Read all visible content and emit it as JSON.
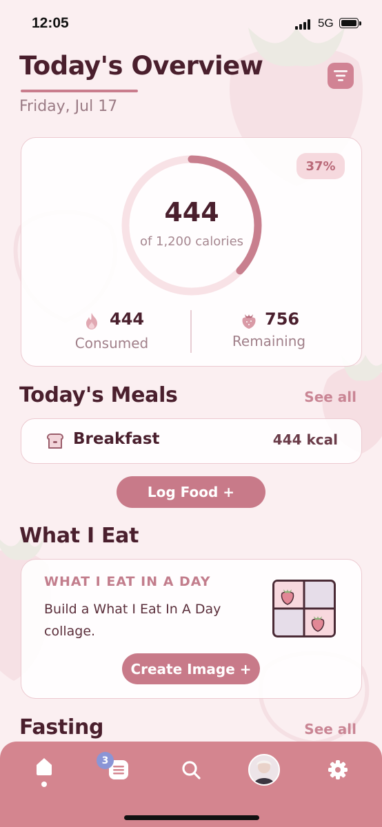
{
  "status_bar": {
    "time": "12:05",
    "network": "5G"
  },
  "header": {
    "title": "Today's Overview",
    "date": "Friday, Jul 17"
  },
  "icons": {
    "filter": "filter-icon",
    "flame": "flame-icon",
    "strawberry": "strawberry-icon",
    "toast": "toast-icon",
    "home": "home-icon",
    "list": "list-icon",
    "search": "search-icon",
    "gear": "gear-icon"
  },
  "summary": {
    "percent_label": "37%",
    "progress": 0.37,
    "consumed": "444",
    "goal_label": "of 1,200 calories",
    "consumed_label": "Consumed",
    "remaining": "756",
    "remaining_label": "Remaining"
  },
  "meals": {
    "title": "Today's Meals",
    "see_all": "See all",
    "items": [
      {
        "name": "Breakfast",
        "kcal": "444 kcal"
      }
    ],
    "log_food_label": "Log Food +"
  },
  "what_i_eat": {
    "title": "What I Eat",
    "kicker": "WHAT I EAT IN A DAY",
    "description": "Build a What I Eat In A Day collage.",
    "button_label": "Create Image +"
  },
  "fasting": {
    "title": "Fasting",
    "see_all": "See all"
  },
  "nav": {
    "notification_count": "3"
  },
  "colors": {
    "accent": "#c87a89",
    "nav_background": "#d4858f",
    "text_dark": "#4a1f2d",
    "badge": "#8a95d6"
  }
}
